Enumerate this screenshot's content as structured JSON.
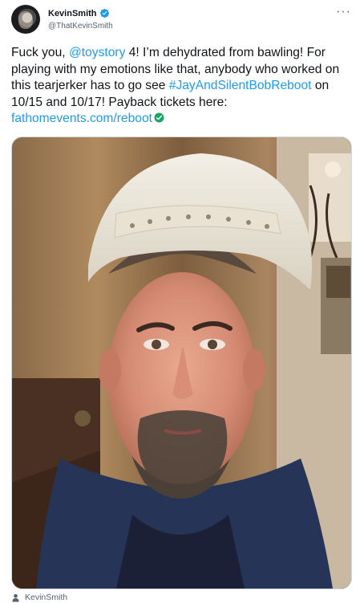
{
  "author": {
    "display_name": "KevinSmith",
    "handle": "@ThatKevinSmith",
    "verified": true,
    "avatar_icon": "user-avatar"
  },
  "more_label": "···",
  "tweet": {
    "part1": "Fuck you, ",
    "mention": "@toystory",
    "part2": " 4! I’m dehydrated from bawling! For playing with my emotions like that, anybody who worked on this tearjerker has to go see ",
    "hashtag": "#JayAndSilentBobReboot",
    "part3": " on 10/15 and 10/17! Payback tickets here: ",
    "link": "fathomevents.com/reboot"
  },
  "media": {
    "icon": "photo-selfie"
  },
  "footer": {
    "tagged_user": "KevinSmith",
    "icon": "person-icon"
  },
  "colors": {
    "accent": "#1d9bf0",
    "text": "#0f1419",
    "secondary": "#536471",
    "check_green": "#19a463"
  }
}
